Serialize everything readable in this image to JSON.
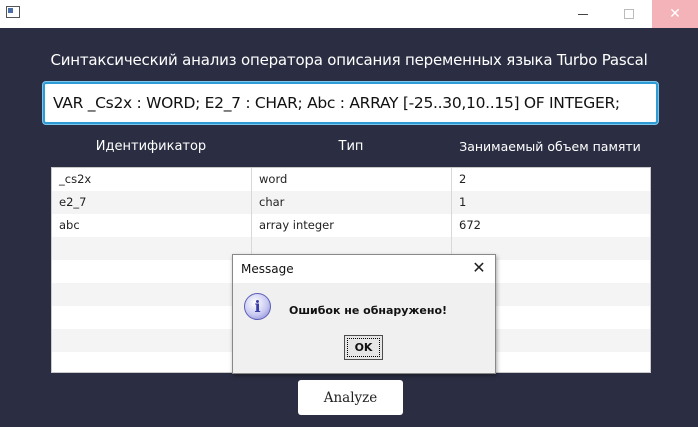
{
  "window": {
    "close_glyph": "✕"
  },
  "heading": "Синтаксический анализ оператора описания переменных языка Turbo Pascal",
  "input": {
    "value": "VAR _Cs2x : WORD; E2_7 : CHAR; Abc : ARRAY [-25..30,10..15] OF INTEGER;"
  },
  "table": {
    "columns": [
      "Идентификатор",
      "Тип",
      "Занимаемый объем памяти"
    ],
    "rows": [
      [
        "_cs2x",
        "word",
        "2"
      ],
      [
        "e2_7",
        "char",
        "1"
      ],
      [
        "abc",
        "array integer",
        "672"
      ],
      [
        "",
        "",
        ""
      ],
      [
        "",
        "",
        ""
      ],
      [
        "",
        "",
        ""
      ],
      [
        "",
        "",
        ""
      ],
      [
        "",
        "",
        ""
      ],
      [
        "",
        "",
        ""
      ]
    ]
  },
  "analyze_label": "Analyze",
  "dialog": {
    "title": "Message",
    "close_glyph": "✕",
    "icon": "info-icon",
    "icon_glyph": "i",
    "message": "Ошибок не обнаружено!",
    "ok_label": "OK"
  },
  "colors": {
    "background": "#2b2e42",
    "input_border": "#2e9bd6",
    "close_hover": "#f4b3b8"
  }
}
